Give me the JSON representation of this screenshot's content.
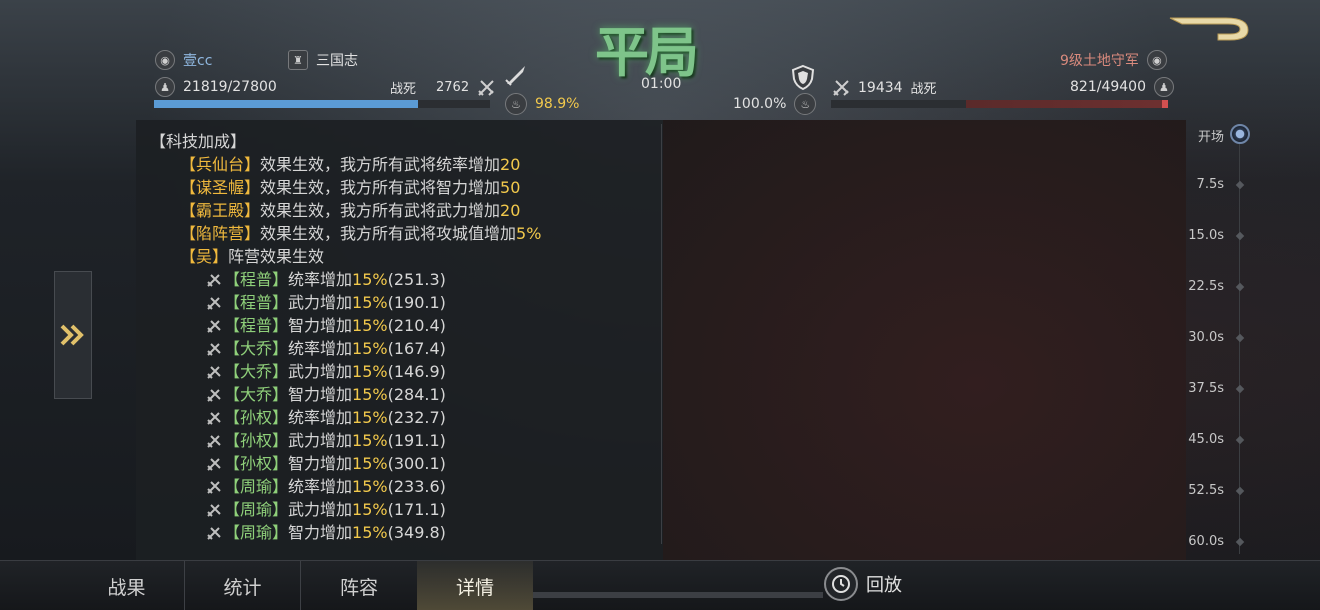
{
  "header": {
    "title": "平局",
    "timer": "01:00",
    "left_player": {
      "name": "壹cc",
      "faction": "三国志",
      "troops": "21819/27800",
      "killed_label": "战死",
      "killed": "2762",
      "morale": "98.9%",
      "troop_fraction": 0.785,
      "bar_color": "#5b9bd5"
    },
    "right_player": {
      "name": "9级土地守军",
      "troops": "821/49400",
      "killed_label": "战死",
      "killed": "19434",
      "morale": "100.0%",
      "troop_fraction": 0.017,
      "bar_color": "#d35050"
    }
  },
  "log": {
    "section_title": "【科技加成】",
    "tech": [
      {
        "name": "【兵仙台】",
        "text": "效果生效，我方所有武将统率增加",
        "value": "20"
      },
      {
        "name": "【谋圣幄】",
        "text": "效果生效，我方所有武将智力增加",
        "value": "50"
      },
      {
        "name": "【霸王殿】",
        "text": "效果生效，我方所有武将武力增加",
        "value": "20"
      },
      {
        "name": "【陷阵营】",
        "text": "效果生效，我方所有武将攻城值增加",
        "value": "5%"
      }
    ],
    "camp": {
      "name": "【吴】",
      "text": "阵营效果生效"
    },
    "buffs": [
      {
        "general": "【程普】",
        "text": "统率增加",
        "pct": "15%",
        "result": "(251.3)"
      },
      {
        "general": "【程普】",
        "text": "武力增加",
        "pct": "15%",
        "result": "(190.1)"
      },
      {
        "general": "【程普】",
        "text": "智力增加",
        "pct": "15%",
        "result": "(210.4)"
      },
      {
        "general": "【大乔】",
        "text": "统率增加",
        "pct": "15%",
        "result": "(167.4)"
      },
      {
        "general": "【大乔】",
        "text": "武力增加",
        "pct": "15%",
        "result": "(146.9)"
      },
      {
        "general": "【大乔】",
        "text": "智力增加",
        "pct": "15%",
        "result": "(284.1)"
      },
      {
        "general": "【孙权】",
        "text": "统率增加",
        "pct": "15%",
        "result": "(232.7)"
      },
      {
        "general": "【孙权】",
        "text": "武力增加",
        "pct": "15%",
        "result": "(191.1)"
      },
      {
        "general": "【孙权】",
        "text": "智力增加",
        "pct": "15%",
        "result": "(300.1)"
      },
      {
        "general": "【周瑜】",
        "text": "统率增加",
        "pct": "15%",
        "result": "(233.6)"
      },
      {
        "general": "【周瑜】",
        "text": "武力增加",
        "pct": "15%",
        "result": "(171.1)"
      },
      {
        "general": "【周瑜】",
        "text": "智力增加",
        "pct": "15%",
        "result": "(349.8)"
      }
    ]
  },
  "timeline": [
    "开场",
    "7.5s",
    "15.0s",
    "22.5s",
    "30.0s",
    "37.5s",
    "45.0s",
    "52.5s",
    "60.0s"
  ],
  "tabs": [
    {
      "label": "战果"
    },
    {
      "label": "统计"
    },
    {
      "label": "阵容"
    },
    {
      "label": "详情"
    }
  ],
  "replay_label": "回放"
}
